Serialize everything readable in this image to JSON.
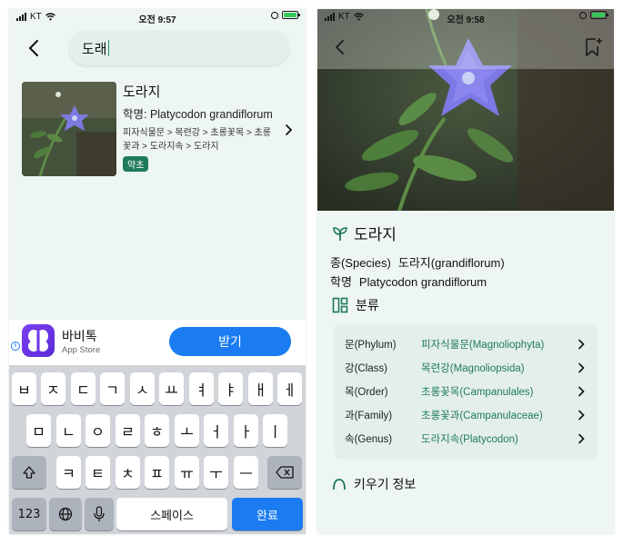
{
  "left": {
    "status": {
      "carrier": "KT",
      "time": "오전 9:57"
    },
    "search": {
      "value": "도래"
    },
    "result": {
      "name": "도라지",
      "scientific": "학명: Platycodon grandiflorum",
      "taxonomy": "피자식물문 > 목련강 > 초롱꽃목 > 초롱꽃과 > 도라지속 > 도라지",
      "tag": "약초"
    },
    "ad": {
      "title": "바비톡",
      "subtitle": "App Store",
      "button": "받기",
      "info": "i"
    },
    "keyboard": {
      "row1": [
        "ㅂ",
        "ㅈ",
        "ㄷ",
        "ㄱ",
        "ㅅ",
        "ㅛ",
        "ㅕ",
        "ㅑ",
        "ㅐ",
        "ㅔ"
      ],
      "row2": [
        "ㅁ",
        "ㄴ",
        "ㅇ",
        "ㄹ",
        "ㅎ",
        "ㅗ",
        "ㅓ",
        "ㅏ",
        "ㅣ"
      ],
      "row3": [
        "ㅋ",
        "ㅌ",
        "ㅊ",
        "ㅍ",
        "ㅠ",
        "ㅜ",
        "ㅡ"
      ],
      "numbers": "123",
      "space": "스페이스",
      "done": "완료"
    }
  },
  "right": {
    "status": {
      "carrier": "KT",
      "time": "오전 9:58"
    },
    "title": "도라지",
    "species_label": "종(Species)",
    "species_value": "도라지(grandiflorum)",
    "sci_label": "학명",
    "sci_value": "Platycodon grandiflorum",
    "section_classification": "분류",
    "taxonomy": [
      {
        "label": "문(Phylum)",
        "value": "피자식물문(Magnoliophyta)"
      },
      {
        "label": "강(Class)",
        "value": "목련강(Magnoliopsida)"
      },
      {
        "label": "목(Order)",
        "value": "초롱꽃목(Campanulales)"
      },
      {
        "label": "과(Family)",
        "value": "초롱꽃과(Campanulaceae)"
      },
      {
        "label": "속(Genus)",
        "value": "도라지속(Platycodon)"
      }
    ],
    "section_next": "키우기 정보"
  },
  "colors": {
    "accent": "#1f7a5c",
    "ios_blue": "#1a7cf0",
    "bg": "#eef6f3",
    "card": "#e4efeb"
  }
}
